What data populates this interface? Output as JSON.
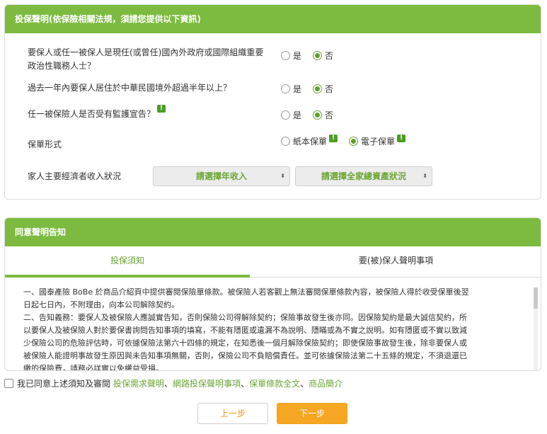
{
  "declaration": {
    "title": "投保聲明(依保險相關法規，須請您提供以下資訊)",
    "q1_line1": "要保人或任一被保人是現任(或曾任)國內外政府或國際組織重要",
    "q1_line2": "政治性職務人士？",
    "q2": "過去一年內要保人居住於中華民國境外超過半年以上？",
    "q3": "任一被保險人是否受有監護宣告？",
    "policy_form_label": "保單形式",
    "income_label": "家人主要經濟者收入狀況",
    "yes": "是",
    "no": "否",
    "paper_policy": "紙本保單",
    "e_policy": "電子保單",
    "tip_glyph": "!",
    "select_income": "請選擇年收入",
    "select_assets": "請選擇全家總資產狀況",
    "caret": "⬍"
  },
  "consent": {
    "title": "同意聲明告知",
    "tab1": "投保須知",
    "tab2": "要(被)保人聲明事項",
    "text_lines": [
      "一、國泰產險 BoBe 於商品介紹頁中提供審閱保險單條款。被保險人若客觀上無法審閱保單條款內容，被保險人得於收受保單後翌",
      "日起七日內，不附理由，向本公司解除契約。",
      "二、告知義務：要保人及被保險人應誠實告知，否則保險公司得解除契約；保險事故發生後亦同。因保險契約是最大誠信契約，所",
      "以要保人及被保險人對於要保書詢問告知事項的填寫，不能有隱匿或遺漏不為說明、隱瞞或為不實之說明。如有隱匿或不實以致減",
      "少保險公司的危險評估時，可依據保險法第六十四條的規定，在知悉後一個月解除保險契約；即使保險事故發生後，除非要保人或",
      "被保險人能證明事故發生原因與未告知事項無關，否則，保險公司不負賠償責任。並可依據保險法第二十五條的規定，不須退還已",
      "繳的保險費，請務必詳實以免權益受損。"
    ]
  },
  "agree": {
    "prefix": "我已同意上述須知及審閱",
    "link1": "投保需求聲明",
    "sep": "、",
    "link2": "網路投保聲明事項",
    "link3": "保單條款全文",
    "link4": "商品簡介"
  },
  "buttons": {
    "prev": "上一步",
    "next": "下一步"
  },
  "colors": {
    "brand_green": "#7cbb3f",
    "accent_orange": "#f5a623"
  }
}
